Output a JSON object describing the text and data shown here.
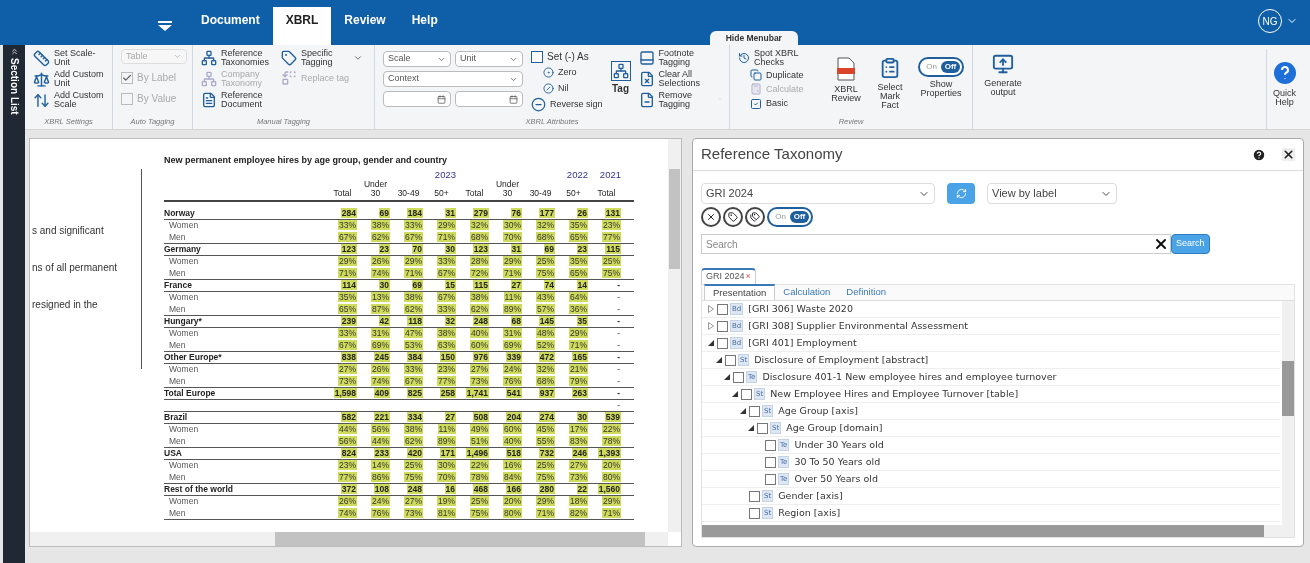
{
  "menu": {
    "tabs": [
      {
        "label": "Document",
        "selected": false
      },
      {
        "label": "XBRL",
        "selected": true
      },
      {
        "label": "Review",
        "selected": false
      },
      {
        "label": "Help",
        "selected": false
      }
    ],
    "hide_menubar": "Hide Menubar",
    "user": "NG"
  },
  "section_list": "Section List",
  "ribbon": {
    "xbrl_settings": {
      "label": "XBRL Settings",
      "buttons": [
        {
          "label": "Set Scale-Unit"
        },
        {
          "label": "Add Custom Unit"
        },
        {
          "label": "Add Custom Scale"
        }
      ]
    },
    "auto_tagging": {
      "label": "Auto Tagging",
      "dropdown": {
        "value": "Table",
        "disabled": true
      },
      "checkboxes": [
        {
          "label": "By Label",
          "checked": true,
          "disabled": true
        },
        {
          "label": "By Value",
          "checked": false,
          "disabled": true
        }
      ]
    },
    "manual_tagging": {
      "label": "Manual Tagging",
      "buttons": [
        {
          "label": "Reference Taxonomies",
          "disabled": false
        },
        {
          "label": "Company Taxonomy",
          "disabled": true
        },
        {
          "label": "Reference Document",
          "disabled": false
        },
        {
          "label": "Specific Tagging",
          "disabled": false
        },
        {
          "label": "Replace tag",
          "disabled": true
        }
      ]
    },
    "xbrl_attributes": {
      "label": "XBRL Attributes",
      "dropdowns": [
        {
          "placeholder": "Scale"
        },
        {
          "placeholder": "Unit"
        },
        {
          "placeholder": "Context"
        }
      ],
      "set_as": {
        "label": "Set (-) As",
        "checked": false
      },
      "options": [
        {
          "label": "Zero"
        },
        {
          "label": "Nil"
        }
      ],
      "reverse_sign": "Reverse sign",
      "tag": "Tag",
      "actions": [
        {
          "label": "Footnote Tagging"
        },
        {
          "label": "Clear All Selections"
        },
        {
          "label": "Remove Tagging"
        }
      ]
    },
    "review": {
      "label": "Review",
      "checks": {
        "label": "Spot XBRL Checks",
        "items": [
          {
            "label": "Duplicate",
            "kind": "button",
            "disabled": false
          },
          {
            "label": "Calculate",
            "kind": "button",
            "disabled": true
          },
          {
            "label": "Basic",
            "kind": "checkbox",
            "checked": true
          }
        ]
      },
      "buttons": [
        {
          "label": "XBRL Review"
        },
        {
          "label": "Select Mark Fact"
        }
      ],
      "show_properties": {
        "label": "Show Properties",
        "on_text": "On",
        "off_text": "Off",
        "on": false
      }
    },
    "generate": "Generate output",
    "quick_help": "Quick Help"
  },
  "document": {
    "fragments": [
      "s and significant",
      "ns of all permanent",
      "resigned in the"
    ],
    "table": {
      "title": "New permanent employee hires by age group, gender and country",
      "column_groups": [
        {
          "year": "2023",
          "columns": [
            "Total",
            "Under 30",
            "30-49",
            "50+"
          ]
        },
        {
          "year": "2022",
          "columns": [
            "Total",
            "Under 30",
            "30-49",
            "50+"
          ]
        },
        {
          "year": "2021",
          "columns": [
            "Total"
          ]
        }
      ],
      "rows": [
        {
          "label": "Norway",
          "kind": "country",
          "cells": [
            {
              "text": "284",
              "tagged": true
            },
            {
              "text": "69",
              "tagged": true
            },
            {
              "text": "184",
              "tagged": true
            },
            {
              "text": "31",
              "tagged": true
            },
            {
              "text": "279",
              "tagged": true
            },
            {
              "text": "76",
              "tagged": true
            },
            {
              "text": "177",
              "tagged": true
            },
            {
              "text": "26",
              "tagged": true
            },
            {
              "text": "131",
              "tagged": true
            }
          ]
        },
        {
          "label": "Women",
          "kind": "gender",
          "cells": [
            {
              "text": "33%",
              "tagged": true
            },
            {
              "text": "38%",
              "tagged": true
            },
            {
              "text": "33%",
              "tagged": true
            },
            {
              "text": "29%",
              "tagged": true
            },
            {
              "text": "32%",
              "tagged": true
            },
            {
              "text": "30%",
              "tagged": true
            },
            {
              "text": "32%",
              "tagged": true
            },
            {
              "text": "35%",
              "tagged": true
            },
            {
              "text": "23%",
              "tagged": true
            }
          ]
        },
        {
          "label": "Men",
          "kind": "gender",
          "cells": [
            {
              "text": "67%",
              "tagged": true
            },
            {
              "text": "62%",
              "tagged": true
            },
            {
              "text": "67%",
              "tagged": true
            },
            {
              "text": "71%",
              "tagged": true
            },
            {
              "text": "68%",
              "tagged": true
            },
            {
              "text": "70%",
              "tagged": true
            },
            {
              "text": "68%",
              "tagged": true
            },
            {
              "text": "65%",
              "tagged": true
            },
            {
              "text": "77%",
              "tagged": true
            }
          ]
        },
        {
          "label": "Germany",
          "kind": "country",
          "cells": [
            {
              "text": "123",
              "tagged": true
            },
            {
              "text": "23",
              "tagged": true
            },
            {
              "text": "70",
              "tagged": true
            },
            {
              "text": "30",
              "tagged": true
            },
            {
              "text": "123",
              "tagged": true
            },
            {
              "text": "31",
              "tagged": true
            },
            {
              "text": "69",
              "tagged": true
            },
            {
              "text": "23",
              "tagged": true
            },
            {
              "text": "115",
              "tagged": true
            }
          ]
        },
        {
          "label": "Women",
          "kind": "gender",
          "cells": [
            {
              "text": "29%",
              "tagged": true
            },
            {
              "text": "26%",
              "tagged": true
            },
            {
              "text": "29%",
              "tagged": true
            },
            {
              "text": "33%",
              "tagged": true
            },
            {
              "text": "28%",
              "tagged": true
            },
            {
              "text": "29%",
              "tagged": true
            },
            {
              "text": "25%",
              "tagged": true
            },
            {
              "text": "35%",
              "tagged": true
            },
            {
              "text": "25%",
              "tagged": true
            }
          ]
        },
        {
          "label": "Men",
          "kind": "gender",
          "cells": [
            {
              "text": "71%",
              "tagged": true
            },
            {
              "text": "74%",
              "tagged": true
            },
            {
              "text": "71%",
              "tagged": true
            },
            {
              "text": "67%",
              "tagged": true
            },
            {
              "text": "72%",
              "tagged": true
            },
            {
              "text": "71%",
              "tagged": true
            },
            {
              "text": "75%",
              "tagged": true
            },
            {
              "text": "65%",
              "tagged": true
            },
            {
              "text": "75%",
              "tagged": true
            }
          ]
        },
        {
          "label": "France",
          "kind": "country",
          "cells": [
            {
              "text": "114",
              "tagged": true
            },
            {
              "text": "30",
              "tagged": true
            },
            {
              "text": "69",
              "tagged": true
            },
            {
              "text": "15",
              "tagged": true
            },
            {
              "text": "115",
              "tagged": true
            },
            {
              "text": "27",
              "tagged": true
            },
            {
              "text": "74",
              "tagged": true
            },
            {
              "text": "14",
              "tagged": true
            },
            {
              "text": "-",
              "tagged": false
            }
          ]
        },
        {
          "label": "Women",
          "kind": "gender",
          "cells": [
            {
              "text": "35%",
              "tagged": true
            },
            {
              "text": "13%",
              "tagged": true
            },
            {
              "text": "38%",
              "tagged": true
            },
            {
              "text": "67%",
              "tagged": true
            },
            {
              "text": "38%",
              "tagged": true
            },
            {
              "text": "11%",
              "tagged": true
            },
            {
              "text": "43%",
              "tagged": true
            },
            {
              "text": "64%",
              "tagged": true
            },
            {
              "text": "-",
              "tagged": false
            }
          ]
        },
        {
          "label": "Men",
          "kind": "gender",
          "cells": [
            {
              "text": "65%",
              "tagged": true
            },
            {
              "text": "87%",
              "tagged": true
            },
            {
              "text": "62%",
              "tagged": true
            },
            {
              "text": "33%",
              "tagged": true
            },
            {
              "text": "62%",
              "tagged": true
            },
            {
              "text": "89%",
              "tagged": true
            },
            {
              "text": "57%",
              "tagged": true
            },
            {
              "text": "36%",
              "tagged": true
            },
            {
              "text": "-",
              "tagged": false
            }
          ]
        },
        {
          "label": "Hungary*",
          "kind": "country",
          "cells": [
            {
              "text": "239",
              "tagged": true
            },
            {
              "text": "42",
              "tagged": true
            },
            {
              "text": "118",
              "tagged": true
            },
            {
              "text": "32",
              "tagged": true
            },
            {
              "text": "248",
              "tagged": true
            },
            {
              "text": "68",
              "tagged": true
            },
            {
              "text": "145",
              "tagged": true
            },
            {
              "text": "35",
              "tagged": true
            },
            {
              "text": "-",
              "tagged": false
            }
          ]
        },
        {
          "label": "Women",
          "kind": "gender",
          "cells": [
            {
              "text": "33%",
              "tagged": true
            },
            {
              "text": "31%",
              "tagged": true
            },
            {
              "text": "47%",
              "tagged": true
            },
            {
              "text": "38%",
              "tagged": true
            },
            {
              "text": "40%",
              "tagged": true
            },
            {
              "text": "31%",
              "tagged": true
            },
            {
              "text": "48%",
              "tagged": true
            },
            {
              "text": "29%",
              "tagged": true
            },
            {
              "text": "-",
              "tagged": false
            }
          ]
        },
        {
          "label": "Men",
          "kind": "gender",
          "cells": [
            {
              "text": "67%",
              "tagged": true
            },
            {
              "text": "69%",
              "tagged": true
            },
            {
              "text": "53%",
              "tagged": true
            },
            {
              "text": "63%",
              "tagged": true
            },
            {
              "text": "60%",
              "tagged": true
            },
            {
              "text": "69%",
              "tagged": true
            },
            {
              "text": "52%",
              "tagged": true
            },
            {
              "text": "71%",
              "tagged": true
            },
            {
              "text": "-",
              "tagged": false
            }
          ]
        },
        {
          "label": "Other Europe*",
          "kind": "country",
          "cells": [
            {
              "text": "838",
              "tagged": true
            },
            {
              "text": "245",
              "tagged": true
            },
            {
              "text": "384",
              "tagged": true
            },
            {
              "text": "150",
              "tagged": true
            },
            {
              "text": "976",
              "tagged": true
            },
            {
              "text": "339",
              "tagged": true
            },
            {
              "text": "472",
              "tagged": true
            },
            {
              "text": "165",
              "tagged": true
            },
            {
              "text": "-",
              "tagged": false
            }
          ]
        },
        {
          "label": "Women",
          "kind": "gender",
          "cells": [
            {
              "text": "27%",
              "tagged": true
            },
            {
              "text": "26%",
              "tagged": true
            },
            {
              "text": "33%",
              "tagged": true
            },
            {
              "text": "23%",
              "tagged": true
            },
            {
              "text": "27%",
              "tagged": true
            },
            {
              "text": "24%",
              "tagged": true
            },
            {
              "text": "32%",
              "tagged": true
            },
            {
              "text": "21%",
              "tagged": true
            },
            {
              "text": "-",
              "tagged": false
            }
          ]
        },
        {
          "label": "Men",
          "kind": "gender",
          "cells": [
            {
              "text": "73%",
              "tagged": true
            },
            {
              "text": "74%",
              "tagged": true
            },
            {
              "text": "67%",
              "tagged": true
            },
            {
              "text": "77%",
              "tagged": true
            },
            {
              "text": "73%",
              "tagged": true
            },
            {
              "text": "76%",
              "tagged": true
            },
            {
              "text": "68%",
              "tagged": true
            },
            {
              "text": "79%",
              "tagged": true
            },
            {
              "text": "-",
              "tagged": false
            }
          ]
        },
        {
          "label": "Total Europe",
          "kind": "country",
          "cells": [
            {
              "text": "1,598",
              "tagged": true
            },
            {
              "text": "409",
              "tagged": true
            },
            {
              "text": "825",
              "tagged": true
            },
            {
              "text": "258",
              "tagged": true
            },
            {
              "text": "1,741",
              "tagged": true
            },
            {
              "text": "541",
              "tagged": true
            },
            {
              "text": "937",
              "tagged": true
            },
            {
              "text": "263",
              "tagged": true
            },
            {
              "text": "-",
              "tagged": false
            }
          ]
        },
        {
          "kind": "spacer",
          "cells": [
            {
              "text": ""
            },
            {
              "text": ""
            },
            {
              "text": ""
            },
            {
              "text": ""
            },
            {
              "text": ""
            },
            {
              "text": ""
            },
            {
              "text": ""
            },
            {
              "text": ""
            },
            {
              "text": "-",
              "tagged": false
            }
          ]
        },
        {
          "label": "Brazil",
          "kind": "country",
          "cells": [
            {
              "text": "582",
              "tagged": true
            },
            {
              "text": "221",
              "tagged": true
            },
            {
              "text": "334",
              "tagged": true
            },
            {
              "text": "27",
              "tagged": true
            },
            {
              "text": "508",
              "tagged": true
            },
            {
              "text": "204",
              "tagged": true
            },
            {
              "text": "274",
              "tagged": true
            },
            {
              "text": "30",
              "tagged": true
            },
            {
              "text": "539",
              "tagged": true
            }
          ]
        },
        {
          "label": "Women",
          "kind": "gender",
          "cells": [
            {
              "text": "44%",
              "tagged": true
            },
            {
              "text": "56%",
              "tagged": true
            },
            {
              "text": "38%",
              "tagged": true
            },
            {
              "text": "11%",
              "tagged": true
            },
            {
              "text": "49%",
              "tagged": true
            },
            {
              "text": "60%",
              "tagged": true
            },
            {
              "text": "45%",
              "tagged": true
            },
            {
              "text": "17%",
              "tagged": true
            },
            {
              "text": "22%",
              "tagged": true
            }
          ]
        },
        {
          "label": "Men",
          "kind": "gender",
          "cells": [
            {
              "text": "56%",
              "tagged": true
            },
            {
              "text": "44%",
              "tagged": true
            },
            {
              "text": "62%",
              "tagged": true
            },
            {
              "text": "89%",
              "tagged": true
            },
            {
              "text": "51%",
              "tagged": true
            },
            {
              "text": "40%",
              "tagged": true
            },
            {
              "text": "55%",
              "tagged": true
            },
            {
              "text": "83%",
              "tagged": true
            },
            {
              "text": "78%",
              "tagged": true
            }
          ]
        },
        {
          "label": "USA",
          "kind": "country",
          "cells": [
            {
              "text": "824",
              "tagged": true
            },
            {
              "text": "233",
              "tagged": true
            },
            {
              "text": "420",
              "tagged": true
            },
            {
              "text": "171",
              "tagged": true
            },
            {
              "text": "1,496",
              "tagged": true
            },
            {
              "text": "518",
              "tagged": true
            },
            {
              "text": "732",
              "tagged": true
            },
            {
              "text": "246",
              "tagged": true
            },
            {
              "text": "1,393",
              "tagged": true
            }
          ]
        },
        {
          "label": "Women",
          "kind": "gender",
          "cells": [
            {
              "text": "23%",
              "tagged": true
            },
            {
              "text": "14%",
              "tagged": true
            },
            {
              "text": "25%",
              "tagged": true
            },
            {
              "text": "30%",
              "tagged": true
            },
            {
              "text": "22%",
              "tagged": true
            },
            {
              "text": "16%",
              "tagged": true
            },
            {
              "text": "25%",
              "tagged": true
            },
            {
              "text": "27%",
              "tagged": true
            },
            {
              "text": "20%",
              "tagged": true
            }
          ]
        },
        {
          "label": "Men",
          "kind": "gender",
          "cells": [
            {
              "text": "77%",
              "tagged": true
            },
            {
              "text": "86%",
              "tagged": true
            },
            {
              "text": "75%",
              "tagged": true
            },
            {
              "text": "70%",
              "tagged": true
            },
            {
              "text": "78%",
              "tagged": true
            },
            {
              "text": "84%",
              "tagged": true
            },
            {
              "text": "75%",
              "tagged": true
            },
            {
              "text": "73%",
              "tagged": true
            },
            {
              "text": "80%",
              "tagged": true
            }
          ]
        },
        {
          "label": "Rest of the world",
          "kind": "country",
          "cells": [
            {
              "text": "372",
              "tagged": true
            },
            {
              "text": "108",
              "tagged": true
            },
            {
              "text": "248",
              "tagged": true
            },
            {
              "text": "16",
              "tagged": true
            },
            {
              "text": "468",
              "tagged": true
            },
            {
              "text": "166",
              "tagged": true
            },
            {
              "text": "280",
              "tagged": true
            },
            {
              "text": "22",
              "tagged": true
            },
            {
              "text": "1,560",
              "tagged": true
            }
          ]
        },
        {
          "label": "Women",
          "kind": "gender",
          "cells": [
            {
              "text": "26%",
              "tagged": true
            },
            {
              "text": "24%",
              "tagged": true
            },
            {
              "text": "27%",
              "tagged": true
            },
            {
              "text": "19%",
              "tagged": true
            },
            {
              "text": "25%",
              "tagged": true
            },
            {
              "text": "20%",
              "tagged": true
            },
            {
              "text": "29%",
              "tagged": true
            },
            {
              "text": "18%",
              "tagged": true
            },
            {
              "text": "29%",
              "tagged": true
            }
          ]
        },
        {
          "label": "Men",
          "kind": "gender",
          "cells": [
            {
              "text": "74%",
              "tagged": true
            },
            {
              "text": "76%",
              "tagged": true
            },
            {
              "text": "73%",
              "tagged": true
            },
            {
              "text": "81%",
              "tagged": true
            },
            {
              "text": "75%",
              "tagged": true
            },
            {
              "text": "80%",
              "tagged": true
            },
            {
              "text": "71%",
              "tagged": true
            },
            {
              "text": "82%",
              "tagged": true
            },
            {
              "text": "71%",
              "tagged": true
            }
          ]
        }
      ]
    }
  },
  "taxonomy_panel": {
    "title": "Reference Taxonomy",
    "taxonomy_select": "GRI 2024",
    "view_select": "View by label",
    "toggle": {
      "on_text": "On",
      "off_text": "Off",
      "on": false
    },
    "search": {
      "placeholder": "Search",
      "button": "Search"
    },
    "doc_tab": {
      "label": "GRI 2024",
      "close": "×"
    },
    "subtabs": [
      {
        "label": "Presentation",
        "selected": true
      },
      {
        "label": "Calculation",
        "selected": false
      },
      {
        "label": "Definition",
        "selected": false
      }
    ],
    "tree": [
      {
        "label": "[GRI 306] Waste 2020",
        "badge": "Bd",
        "checked": false,
        "expanded": false
      },
      {
        "label": "[GRI 308] Supplier Environmental Assessment",
        "badge": "Bd",
        "checked": false,
        "expanded": false
      },
      {
        "label": "[GRI 401] Employment",
        "badge": "Bd",
        "checked": false,
        "expanded": true,
        "children": [
          {
            "label": "Disclosure of Employment [abstract]",
            "badge": "St",
            "checked": false,
            "expanded": true,
            "children": [
              {
                "label": "Disclosure 401-1 New employee hires and employee turnover",
                "badge": "Te",
                "checked": false,
                "expanded": true,
                "children": [
                  {
                    "label": "New Employee Hires and Employee Turnover [table]",
                    "badge": "St",
                    "checked": false,
                    "expanded": true,
                    "children": [
                      {
                        "label": "Age Group [axis]",
                        "badge": "St",
                        "checked": false,
                        "expanded": true,
                        "children": [
                          {
                            "label": "Age Group [domain]",
                            "badge": "St",
                            "checked": false,
                            "expanded": true,
                            "children": [
                              {
                                "label": "Under 30 Years old",
                                "badge": "Te",
                                "checked": false
                              },
                              {
                                "label": "30 To 50 Years old",
                                "badge": "Te",
                                "checked": false
                              },
                              {
                                "label": "Over 50 Years old",
                                "badge": "Te",
                                "checked": false
                              }
                            ]
                          }
                        ]
                      },
                      {
                        "label": "Gender [axis]",
                        "badge": "St",
                        "checked": false
                      },
                      {
                        "label": "Region [axis]",
                        "badge": "St",
                        "checked": false
                      }
                    ]
                  }
                ]
              }
            ]
          }
        ]
      }
    ]
  }
}
